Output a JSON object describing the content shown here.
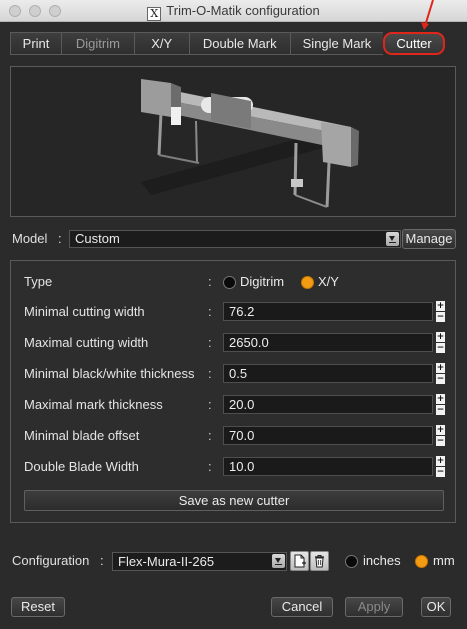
{
  "window": {
    "title": "Trim-O-Matik configuration"
  },
  "tabs": [
    {
      "label": "Print",
      "state": "normal"
    },
    {
      "label": "Digitrim",
      "state": "disabled"
    },
    {
      "label": "X/Y",
      "state": "normal"
    },
    {
      "label": "Double Mark",
      "state": "normal"
    },
    {
      "label": "Single Mark",
      "state": "normal"
    },
    {
      "label": "Cutter",
      "state": "active"
    }
  ],
  "model": {
    "label": "Model",
    "colon": ":",
    "value": "Custom",
    "manage_label": "Manage"
  },
  "cutter": {
    "type": {
      "label": "Type",
      "options": [
        {
          "label": "Digitrim",
          "selected": false
        },
        {
          "label": "X/Y",
          "selected": true
        }
      ]
    },
    "fields": [
      {
        "label": "Minimal cutting width",
        "value": "76.2"
      },
      {
        "label": "Maximal cutting width",
        "value": "2650.0"
      },
      {
        "label": "Minimal black/white thickness",
        "value": "0.5"
      },
      {
        "label": "Maximal mark thickness",
        "value": "20.0"
      },
      {
        "label": "Minimal blade offset",
        "value": "70.0"
      },
      {
        "label": "Double Blade Width",
        "value": "10.0"
      }
    ],
    "spin_up": "+",
    "spin_down": "−",
    "save_label": "Save as new cutter"
  },
  "configuration": {
    "label": "Configuration",
    "colon": ":",
    "value": "Flex-Mura-II-265",
    "units": [
      {
        "label": "inches",
        "selected": false
      },
      {
        "label": "mm",
        "selected": true
      }
    ]
  },
  "footer": {
    "reset_label": "Reset",
    "cancel_label": "Cancel",
    "apply_label": "Apply",
    "ok_label": "OK"
  },
  "colors": {
    "accent_radio": "#f39b12",
    "active_tab_outline": "#e0261b",
    "background": "#2b2b2b"
  }
}
